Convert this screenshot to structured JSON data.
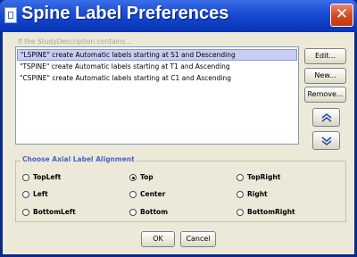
{
  "window": {
    "title": "Spine Label Preferences",
    "close_glyph": "✕"
  },
  "caption": "If the StudyDescription contains...",
  "rules": [
    {
      "text": "\"LSPINE\" create Automatic labels starting at S1 and Descending",
      "selected": true
    },
    {
      "text": "\"TSPINE\" create Automatic labels starting at T1 and Ascending",
      "selected": false
    },
    {
      "text": "\"CSPINE\" create Automatic labels starting at C1 and Ascending",
      "selected": false
    }
  ],
  "side_buttons": {
    "edit": "Edit...",
    "new": "New...",
    "remove": "Remove..."
  },
  "alignment": {
    "title": "Choose Axial Label Alignment",
    "selected": "Top",
    "options": [
      "TopLeft",
      "Top",
      "TopRight",
      "Left",
      "Center",
      "Right",
      "BottomLeft",
      "Bottom",
      "BottomRight"
    ]
  },
  "footer": {
    "ok": "OK",
    "cancel": "Cancel"
  },
  "icons": {
    "move_up": "chevron-double-up-icon",
    "move_down": "chevron-double-down-icon"
  },
  "colors": {
    "titlebar": "#1f52d6",
    "close": "#d2481e",
    "selection": "#c9cdf4",
    "group_title": "#4a64c8"
  }
}
